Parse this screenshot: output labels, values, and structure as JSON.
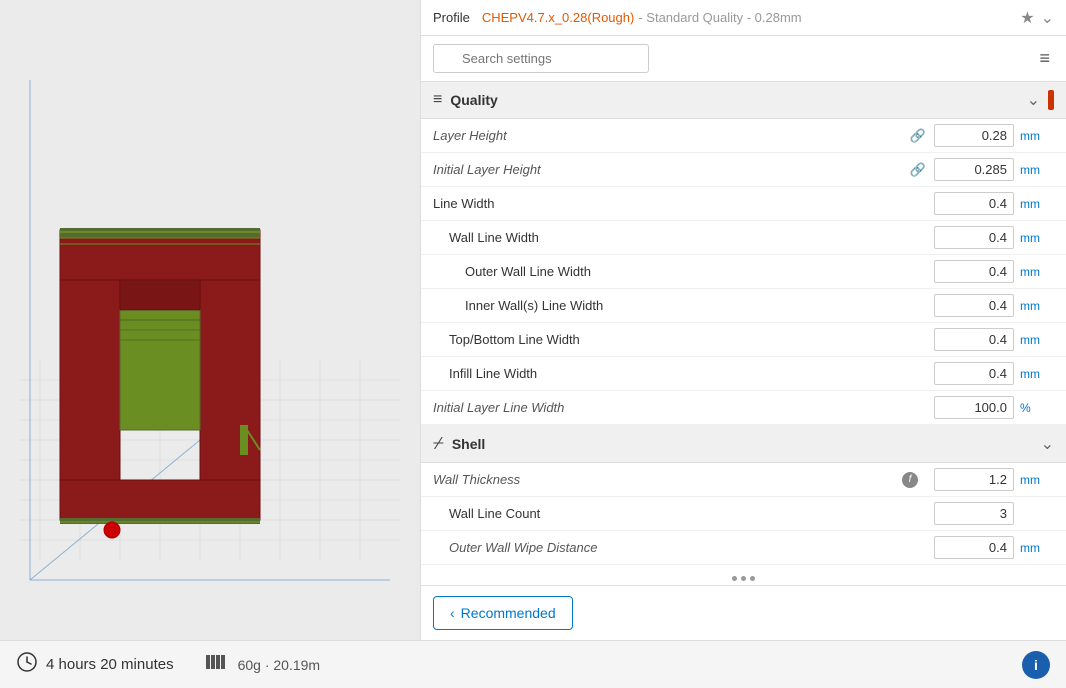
{
  "profile": {
    "label": "Profile",
    "value": "CHEPV4.7.x_0.28(Rough)",
    "quality": "- Standard Quality - 0.28mm"
  },
  "search": {
    "placeholder": "Search settings"
  },
  "quality_section": {
    "title": "Quality",
    "icon": "☰",
    "settings": [
      {
        "name": "Layer Height",
        "value": "0.28",
        "unit": "mm",
        "link": true,
        "indent": 0
      },
      {
        "name": "Initial Layer Height",
        "value": "0.285",
        "unit": "mm",
        "link": true,
        "indent": 0
      },
      {
        "name": "Line Width",
        "value": "0.4",
        "unit": "mm",
        "link": false,
        "indent": 0
      },
      {
        "name": "Wall Line Width",
        "value": "0.4",
        "unit": "mm",
        "link": false,
        "indent": 1
      },
      {
        "name": "Outer Wall Line Width",
        "value": "0.4",
        "unit": "mm",
        "link": false,
        "indent": 2
      },
      {
        "name": "Inner Wall(s) Line Width",
        "value": "0.4",
        "unit": "mm",
        "link": false,
        "indent": 2
      },
      {
        "name": "Top/Bottom Line Width",
        "value": "0.4",
        "unit": "mm",
        "link": false,
        "indent": 1
      },
      {
        "name": "Infill Line Width",
        "value": "0.4",
        "unit": "mm",
        "link": false,
        "indent": 1
      },
      {
        "name": "Initial Layer Line Width",
        "value": "100.0",
        "unit": "%",
        "link": false,
        "indent": 0
      }
    ]
  },
  "shell_section": {
    "title": "Shell",
    "icon": "⌿",
    "settings": [
      {
        "name": "Wall Thickness",
        "value": "1.2",
        "unit": "mm",
        "func": true,
        "indent": 0
      },
      {
        "name": "Wall Line Count",
        "value": "3",
        "unit": "",
        "func": false,
        "indent": 1
      },
      {
        "name": "Outer Wall Wipe Distance",
        "value": "0.4",
        "unit": "mm",
        "func": false,
        "indent": 1
      }
    ]
  },
  "dots": [
    "•",
    "•",
    "•"
  ],
  "recommended_btn": "Recommended",
  "status": {
    "time_icon": "⏱",
    "time": "4 hours 20 minutes",
    "material_icon": "▮▮▮▮",
    "material": "60g · 20.19m"
  }
}
